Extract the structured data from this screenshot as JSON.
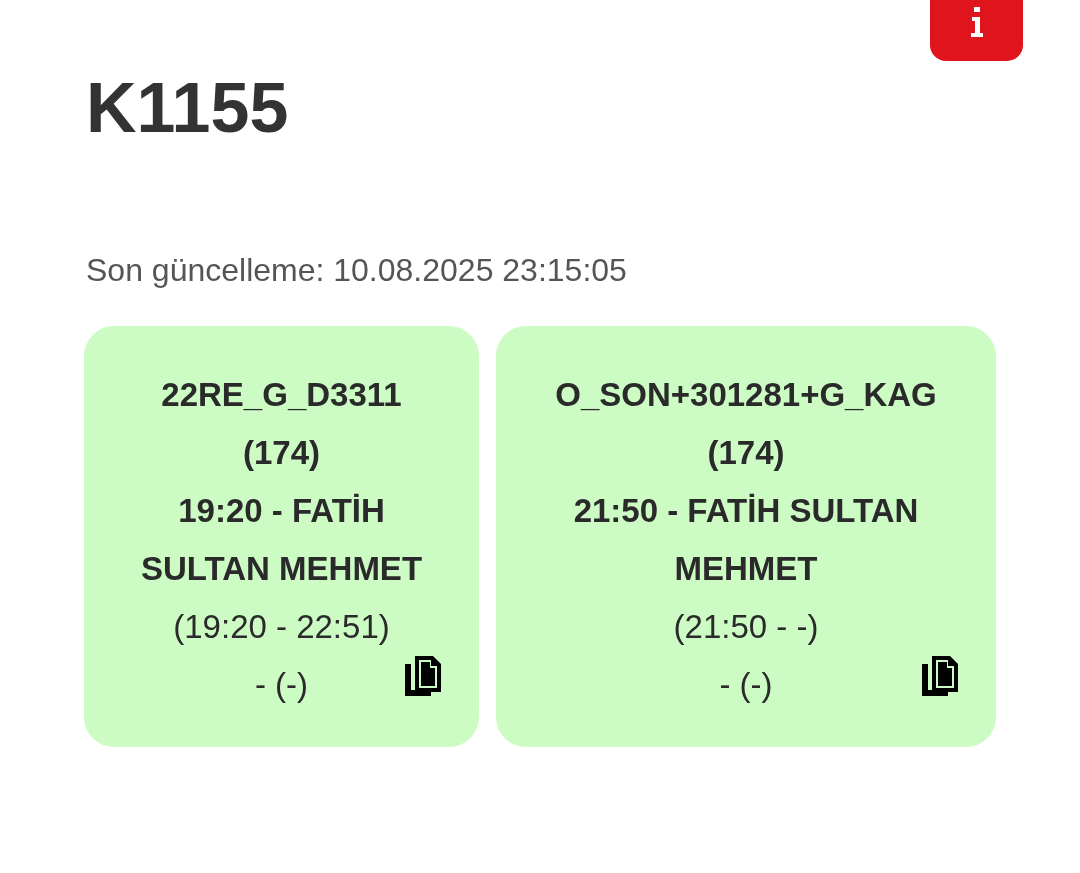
{
  "title": "K1155",
  "last_update": "Son güncelleme: 10.08.2025 23:15:05",
  "cards": [
    {
      "code": "22RE_G_D3311",
      "count": "(174)",
      "trip": "19:20 - FATİH SULTAN MEHMET",
      "times": "(19:20 - 22:51)",
      "extra": "- (-)"
    },
    {
      "code": "O_SON+301281+G_KAG",
      "count": "(174)",
      "trip": "21:50 - FATİH SULTAN MEHMET",
      "times": "(21:50 - -)",
      "extra": "- (-)"
    }
  ]
}
